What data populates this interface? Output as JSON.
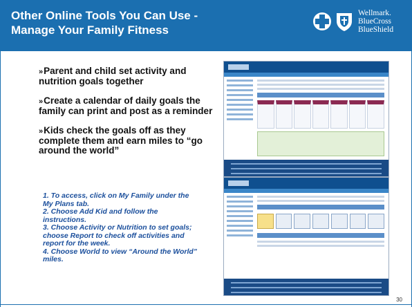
{
  "header": {
    "title_line1": "Other Online Tools You Can Use -",
    "title_line2": "Manage Your Family Fitness",
    "logo_text": [
      "Wellmark.",
      "BlueCross",
      "BlueShield"
    ],
    "color": "#1b6fb0"
  },
  "bullets": [
    "Parent and child set activity and nutrition goals together",
    "Create a calendar of daily goals the family can print and post as a reminder",
    "Kids check the goals off as they complete them and earn miles to “go around the world”"
  ],
  "bullet_marker": "»",
  "steps": [
    "1. To access, click on My Family under the My Plans tab.",
    "2. Choose Add Kid and follow the instructions.",
    "3. Choose Activity or Nutrition to set goals; choose Report to check off activities and report for the week.",
    "4. Choose World to view “Around the World” miles."
  ],
  "steps_color": "#1b4f9c",
  "page_number": "30"
}
